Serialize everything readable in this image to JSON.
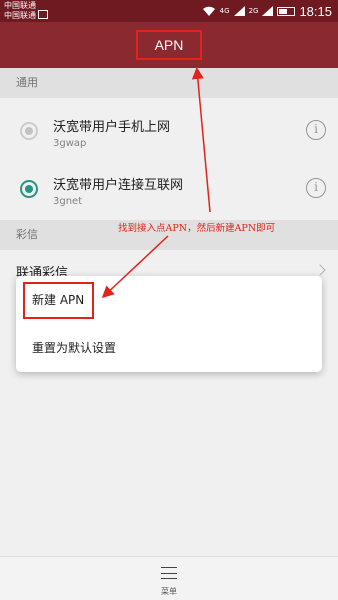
{
  "status_bar": {
    "carrier_1": "中国联通",
    "carrier_2": "中国联通",
    "net_1": "4G",
    "net_2": "2G",
    "time": "18:15"
  },
  "title_bar": {
    "title": "APN"
  },
  "sections": {
    "general": "通用",
    "mms": "彩信"
  },
  "apn_list": [
    {
      "name": "沃宽带用户手机上网",
      "apn": "3gwap",
      "selected": false
    },
    {
      "name": "沃宽带用户连接互联网",
      "apn": "3gnet",
      "selected": true
    }
  ],
  "mms_item": {
    "label": "联通彩信"
  },
  "popup_menu": {
    "new_apn": "新建 APN",
    "reset": "重置为默认设置"
  },
  "annotation": {
    "text": "找到接入点APN，然后新建APN即可"
  },
  "bottom_bar": {
    "menu_label": "菜单"
  },
  "colors": {
    "title_bar": "#8a2a30",
    "highlight": "#e2231a",
    "radio_selected": "#2a9e8b"
  },
  "icons": [
    "wifi-icon",
    "signal-icon",
    "battery-icon",
    "info-icon",
    "chevron-right-icon",
    "menu-icon"
  ]
}
